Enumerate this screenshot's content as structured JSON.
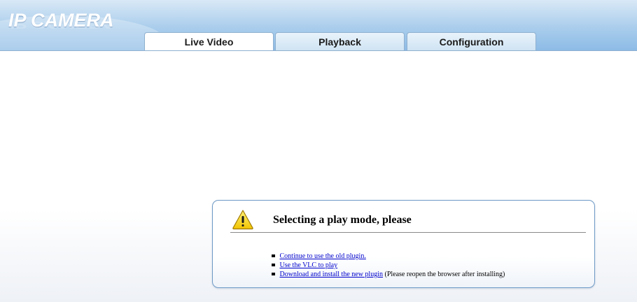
{
  "header": {
    "logo": "IP CAMERA",
    "tabs": [
      {
        "label": "Live Video",
        "active": true
      },
      {
        "label": "Playback",
        "active": false
      },
      {
        "label": "Configuration",
        "active": false
      }
    ]
  },
  "dialog": {
    "icon": "warning-icon",
    "title": "Selecting a play mode, please",
    "options": [
      {
        "link": "Continue to use the old plugin.",
        "note": ""
      },
      {
        "link": "Use the VLC to play",
        "note": ""
      },
      {
        "link": "Download and install the new plugin",
        "note": "(Please reopen the browser after installing)"
      }
    ]
  },
  "colors": {
    "header_top": "#d9e8f6",
    "header_bottom": "#8dbbe6",
    "link": "#0000cc",
    "warning_yellow": "#f5d000"
  }
}
